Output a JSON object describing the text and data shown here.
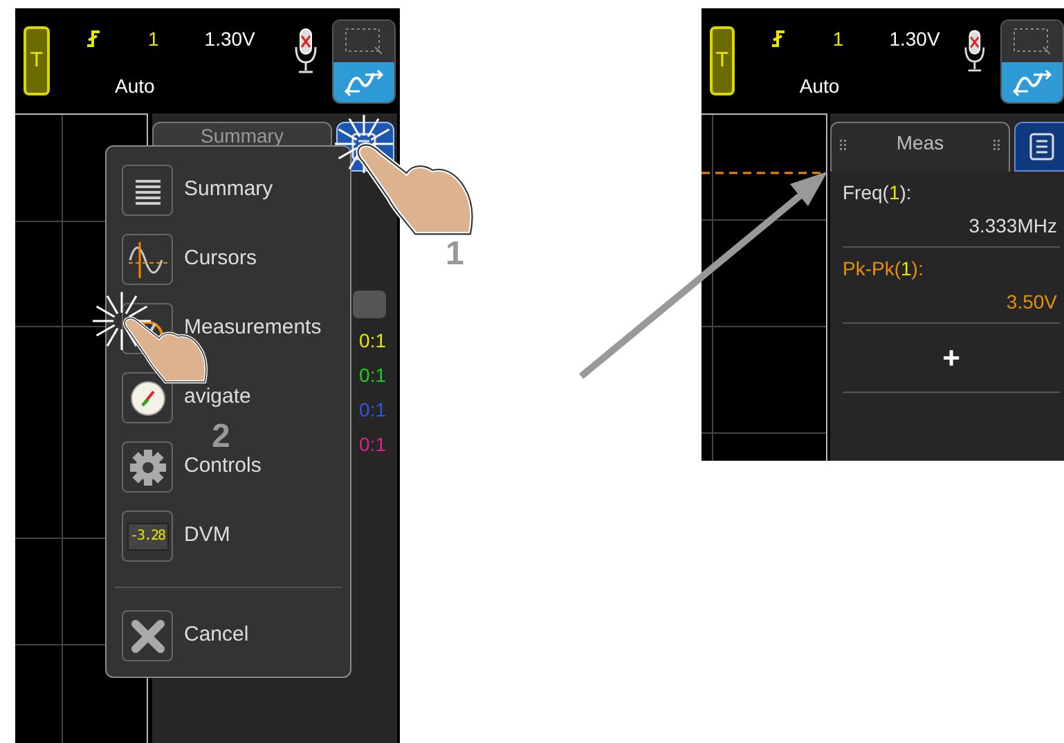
{
  "left_screen": {
    "header": {
      "trigger_button": "T",
      "trigger_channel": "1",
      "trigger_level": "1.30V",
      "trigger_mode": "Auto"
    },
    "tabs": [
      {
        "label": "Summary",
        "kind": "text",
        "selected": false
      },
      {
        "kind": "icon",
        "selected": true
      }
    ],
    "channel_labels": [
      {
        "text": "0:1",
        "color": "#e8e800"
      },
      {
        "text": "0:1",
        "color": "#22cc22"
      },
      {
        "text": "0:1",
        "color": "#3355dd"
      },
      {
        "text": "0:1",
        "color": "#dd2288"
      }
    ],
    "menu": {
      "items": [
        {
          "label": "Summary",
          "kind": "list"
        },
        {
          "label": "Cursors",
          "kind": "cursors"
        },
        {
          "label": "Measurements",
          "kind": "meter"
        },
        {
          "label": "avigate",
          "kind": "compass"
        },
        {
          "label": "Controls",
          "kind": "gear"
        },
        {
          "label": "DVM",
          "kind": "dvm",
          "reading": "-3.28"
        }
      ],
      "cancel": "Cancel"
    }
  },
  "steps": [
    "1",
    "2"
  ],
  "right_screen": {
    "header": {
      "trigger_button": "T",
      "trigger_channel": "1",
      "trigger_level": "1.30V",
      "trigger_mode": "Auto"
    },
    "tabs": [
      {
        "label": "Meas",
        "kind": "text",
        "selected": true
      },
      {
        "kind": "icon",
        "selected": false
      }
    ],
    "measurements": [
      {
        "label": "Freq(",
        "channel": "1",
        "label_end": "):",
        "value": "3.333MHz",
        "color": "#dddddd"
      },
      {
        "label": "Pk-Pk(",
        "channel": "1",
        "label_end": "):",
        "value": "3.50V",
        "color": "#e8900a"
      }
    ],
    "add_button": "+"
  }
}
